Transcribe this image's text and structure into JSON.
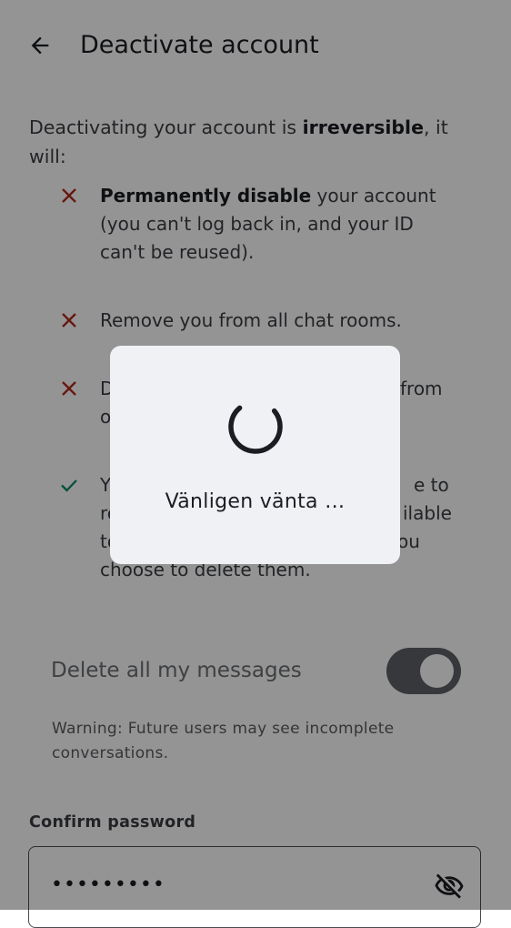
{
  "header": {
    "title": "Deactivate account",
    "back_icon": "arrow-back-icon"
  },
  "intro": {
    "prefix": "Deactivating your account is ",
    "bold": "irreversible",
    "suffix": ", it will:"
  },
  "consequences": [
    {
      "icon": "cross-icon",
      "bold": "Permanently disable",
      "text": " your account (you can't log back in, and your ID can't be reused)."
    },
    {
      "icon": "cross-icon",
      "bold": "",
      "text": "Remove you from all chat rooms."
    },
    {
      "icon": "cross-icon",
      "visible_start": "D",
      "visible_end": "from",
      "visible_line2": "o"
    },
    {
      "icon": "check-icon",
      "line1_start": "Y",
      "line1_end": "e to",
      "line2_start": "re",
      "line2_end": "ilable",
      "line3_start": "to",
      "line3_end": "ou",
      "line4": "choose to delete them."
    }
  ],
  "delete_messages": {
    "label": "Delete all my messages",
    "enabled": true
  },
  "warning": "Warning: Future users may see incomplete conversations.",
  "password": {
    "label": "Confirm password",
    "value": "•••••••••",
    "toggle_icon": "visibility-off-icon"
  },
  "dialog": {
    "message": "Vänligen vänta …",
    "icon": "loading-spinner-icon"
  },
  "colors": {
    "cross": "#b3261e",
    "check": "#0b8a6b",
    "scrim": "rgba(0,0,0,0.42)",
    "dialog_bg": "#f0f1f5"
  }
}
